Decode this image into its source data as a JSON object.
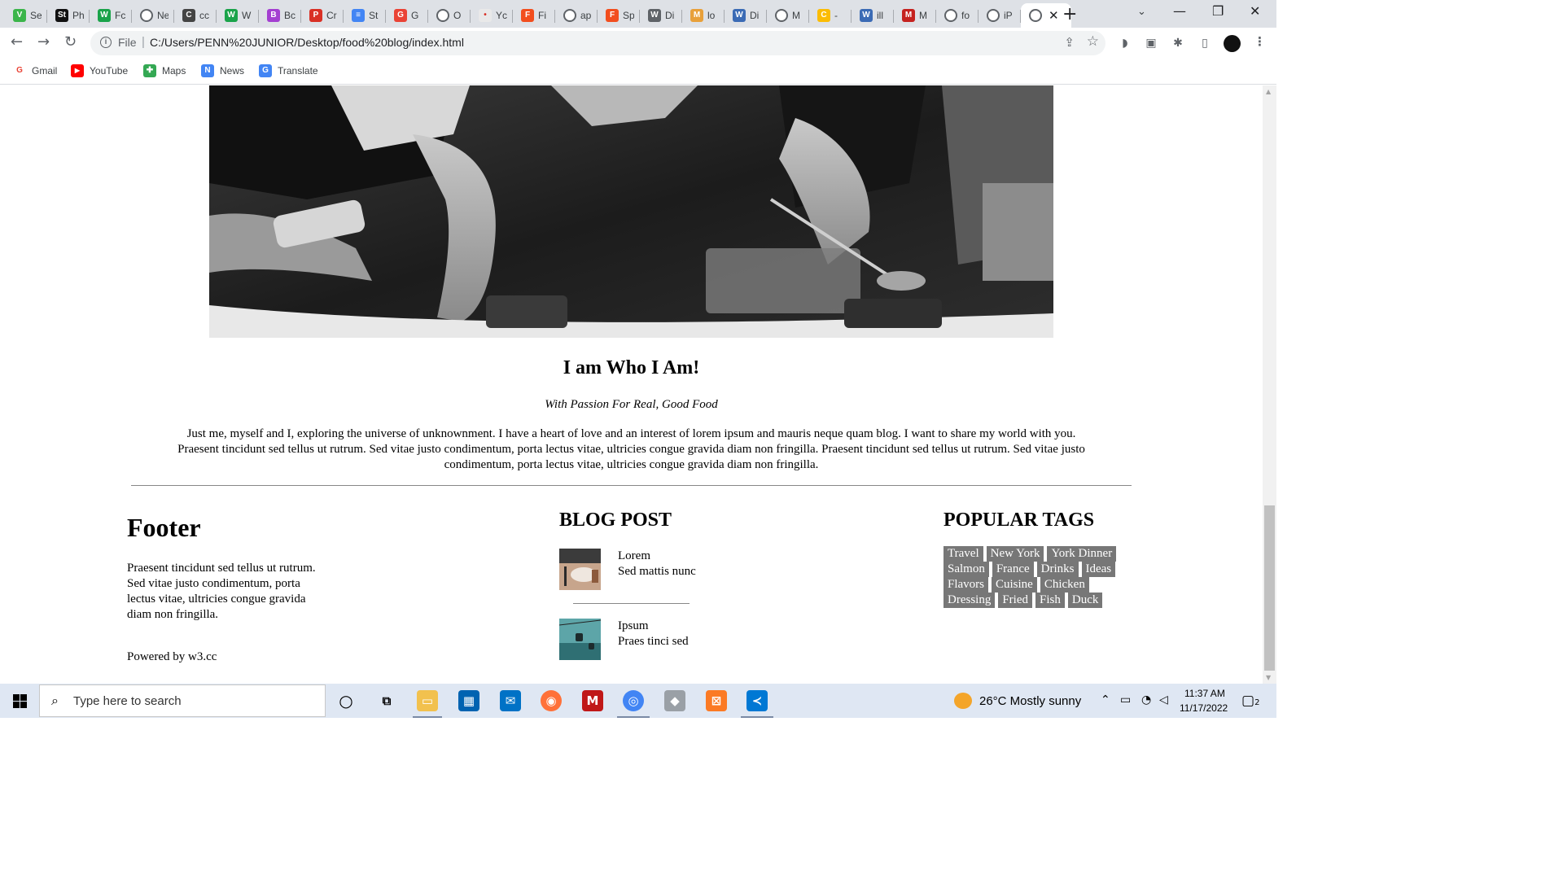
{
  "browser": {
    "tabs": [
      {
        "abbr": "Se",
        "badge": "V",
        "color": "#3bb54a"
      },
      {
        "abbr": "Ph",
        "badge": "St",
        "color": "#111111"
      },
      {
        "abbr": "Fc",
        "badge": "W",
        "color": "#1aa34a"
      },
      {
        "abbr": "Ne",
        "badge": "",
        "color": "globe"
      },
      {
        "abbr": "cc",
        "badge": "C",
        "color": "#444444"
      },
      {
        "abbr": "W",
        "badge": "W",
        "color": "#1aa34a"
      },
      {
        "abbr": "Bc",
        "badge": "B",
        "color": "#a43fd1"
      },
      {
        "abbr": "Cr",
        "badge": "P",
        "color": "#d93025"
      },
      {
        "abbr": "St",
        "badge": "≡",
        "color": "#4285f4"
      },
      {
        "abbr": "G",
        "badge": "G",
        "color": "#ea4335"
      },
      {
        "abbr": "O",
        "badge": "",
        "color": "globe"
      },
      {
        "abbr": "Yc",
        "badge": "•",
        "color": "#e9e9e9"
      },
      {
        "abbr": "Fi",
        "badge": "F",
        "color": "#f24e1e"
      },
      {
        "abbr": "ap",
        "badge": "",
        "color": "globe"
      },
      {
        "abbr": "Sp",
        "badge": "F",
        "color": "#f24e1e"
      },
      {
        "abbr": "Di",
        "badge": "W",
        "color": "#5f6368"
      },
      {
        "abbr": "lo",
        "badge": "M",
        "color": "#e8a03a"
      },
      {
        "abbr": "Di",
        "badge": "W",
        "color": "#3b6bb5"
      },
      {
        "abbr": "M",
        "badge": "",
        "color": "globe"
      },
      {
        "abbr": "-",
        "badge": "C",
        "color": "#fbbc04"
      },
      {
        "abbr": "ill",
        "badge": "W",
        "color": "#3b6bb5"
      },
      {
        "abbr": "M",
        "badge": "M",
        "color": "#c5221f"
      },
      {
        "abbr": "fo",
        "badge": "",
        "color": "globe"
      },
      {
        "abbr": "iP",
        "badge": "",
        "color": "globe"
      }
    ],
    "active_tab": {
      "badge": "",
      "close": "✕"
    },
    "new_tab": "+",
    "file_label": "File",
    "url": "C:/Users/PENN%20JUNIOR/Desktop/food%20blog/index.html",
    "bookmarks": [
      {
        "label": "Gmail",
        "badge": "G",
        "color": "#ea4335"
      },
      {
        "label": "YouTube",
        "badge": "▶",
        "color": "#ff0000"
      },
      {
        "label": "Maps",
        "badge": "✚",
        "color": "#34a853"
      },
      {
        "label": "News",
        "badge": "N",
        "color": "#4285f4"
      },
      {
        "label": "Translate",
        "badge": "G",
        "color": "#4285f4"
      }
    ]
  },
  "page": {
    "intro": {
      "heading": "I am Who I Am!",
      "subheading": "With Passion For Real, Good Food",
      "body": "Just me, myself and I, exploring the universe of unknownment. I have a heart of love and an interest of lorem ipsum and mauris neque quam blog. I want to share my world with you. Praesent tincidunt sed tellus ut rutrum. Sed vitae justo condimentum, porta lectus vitae, ultricies congue gravida diam non fringilla. Praesent tincidunt sed tellus ut rutrum. Sed vitae justo condimentum, porta lectus vitae, ultricies congue gravida diam non fringilla."
    },
    "footer": {
      "title": "Footer",
      "text": "Praesent tincidunt sed tellus ut rutrum. Sed vitae justo condimentum, porta lectus vitae, ultricies congue gravida diam non fringilla.",
      "powered": "Powered by w3.cc"
    },
    "blog": {
      "title": "BLOG POST",
      "posts": [
        {
          "title": "Lorem",
          "subtitle": "Sed mattis nunc"
        },
        {
          "title": "Ipsum",
          "subtitle": "Praes tinci sed"
        }
      ]
    },
    "tags": {
      "title": "POPULAR TAGS",
      "items": [
        "Travel",
        "New York",
        "York Dinner",
        "Salmon",
        "France",
        "Drinks",
        "Ideas",
        "Flavors",
        "Cuisine",
        "Chicken",
        "Dressing",
        "Fried",
        "Fish",
        "Duck"
      ]
    }
  },
  "taskbar": {
    "search_placeholder": "Type here to search",
    "weather": "26°C  Mostly sunny",
    "time": "11:37 AM",
    "date": "11/17/2022",
    "notification_count": "2"
  }
}
